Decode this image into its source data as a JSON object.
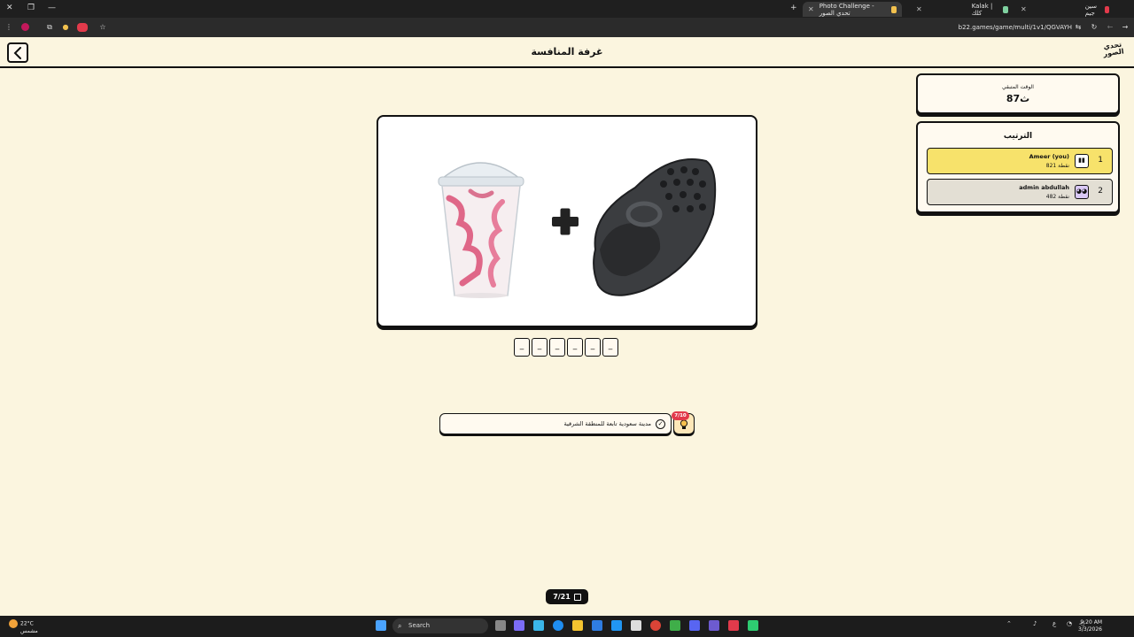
{
  "browser": {
    "tabs": [
      {
        "label": "Photo Challenge - تحدي الصور",
        "active": true
      },
      {
        "label": "Kalak | كلك",
        "active": false
      },
      {
        "label": "سين جيم",
        "active": false
      }
    ],
    "url": "b22.games/game/multi/1v1/QGVAYH"
  },
  "header": {
    "title": "غرفة المنافسة",
    "logo_text": "تحدي الصور"
  },
  "timer": {
    "label": "الوقت المتبقي",
    "value": "87ث"
  },
  "ranking": {
    "title": "الترتيب",
    "rows": [
      {
        "rank": "1",
        "name": "Ameer (you)",
        "points": "821 نقطة",
        "color": "#f7e26b"
      },
      {
        "rank": "2",
        "name": "admin abdullah",
        "points": "482 نقطة",
        "color": "#e3dfd4"
      }
    ]
  },
  "puzzle": {
    "left_item": "milkshake-cup",
    "operator": "+",
    "right_item": "clog-shoe"
  },
  "answer_slots": [
    "_",
    "_",
    "_",
    "_",
    "_",
    "_"
  ],
  "hint": {
    "text": "مدينة سعودية تابعة للمنطقة الشرقية",
    "badge": "7/10",
    "button_icon": "lightbulb-icon"
  },
  "progress": {
    "label": "7/21"
  },
  "taskbar": {
    "temperature": "22°C",
    "weather_text": "مشمس",
    "search_placeholder": "Search",
    "time": "9:20 AM",
    "date": "3/3/2026",
    "lang": "ع"
  }
}
